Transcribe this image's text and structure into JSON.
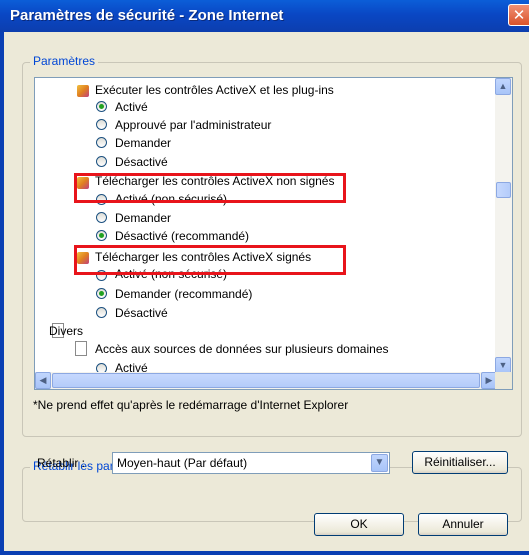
{
  "window": {
    "title": "Paramètres de sécurité - Zone Internet",
    "close_symbol": "✕"
  },
  "settings_group": {
    "label": "Paramètres"
  },
  "tree": {
    "activex_run": {
      "label": "Exécuter les contrôles ActiveX et les plug-ins",
      "options": [
        "Activé",
        "Approuvé par l'administrateur",
        "Demander",
        "Désactivé"
      ],
      "selected": 0
    },
    "download_unsigned": {
      "label": "Télécharger les contrôles ActiveX non signés",
      "options": [
        "Activé (non sécurisé)",
        "Demander",
        "Désactivé (recommandé)"
      ],
      "selected": 2
    },
    "download_signed": {
      "label": "Télécharger les contrôles ActiveX signés",
      "options": [
        "Activé (non sécurisé)",
        "Demander (recommandé)",
        "Désactivé"
      ],
      "selected": 1
    },
    "misc": {
      "label": "Divers",
      "data_access_label": "Accès aux sources de données sur plusieurs domaines",
      "data_access_first_option": "Activé"
    }
  },
  "note": "*Ne prend effet qu'après le redémarrage d'Internet Explorer",
  "reset_group": {
    "label": "Rétablir les paramètres personnalisés",
    "reset_label": "Rétablir :",
    "reset_value": "Moyen-haut (Par défaut)",
    "reset_button": "Réinitialiser..."
  },
  "buttons": {
    "ok": "OK",
    "cancel": "Annuler"
  },
  "colors": {
    "highlight": "#e8141b",
    "title_bar": "#0a47c4",
    "group_label": "#0046d5"
  }
}
